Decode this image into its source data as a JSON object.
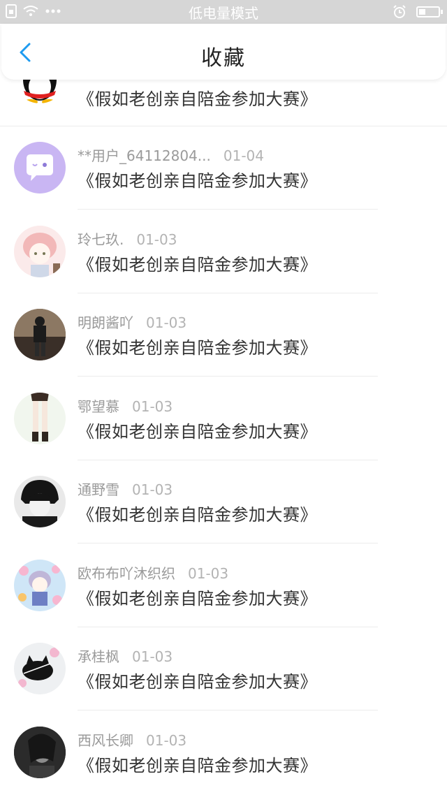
{
  "status_bar": {
    "title": "低电量模式"
  },
  "nav": {
    "title": "收藏"
  },
  "items": [
    {
      "name": "",
      "date": "",
      "text": "《假如老创亲自陪金参加大赛》",
      "avatar": "qq-penguin-avatar"
    },
    {
      "name": "**用户_64112804...",
      "date": "01-04",
      "text": "《假如老创亲自陪金参加大赛》",
      "avatar": "purple-chat-avatar"
    },
    {
      "name": "玲七玖.",
      "date": "01-03",
      "text": "《假如老创亲自陪金参加大赛》",
      "avatar": "anime-pink-hair-avatar"
    },
    {
      "name": "明朗酱吖",
      "date": "01-03",
      "text": "《假如老创亲自陪金参加大赛》",
      "avatar": "street-photo-avatar"
    },
    {
      "name": "鄂望慕",
      "date": "01-03",
      "text": "《假如老创亲自陪金参加大赛》",
      "avatar": "legs-avatar"
    },
    {
      "name": "通野雪",
      "date": "01-03",
      "text": "《假如老创亲自陪金参加大赛》",
      "avatar": "dark-hair-boy-avatar"
    },
    {
      "name": "欧布布吖沐织织",
      "date": "01-03",
      "text": "《假如老创亲自陪金参加大赛》",
      "avatar": "anime-girl-flowers-avatar"
    },
    {
      "name": "承桂枫",
      "date": "01-03",
      "text": "《假如老创亲自陪金参加大赛》",
      "avatar": "black-cat-avatar"
    },
    {
      "name": "西风长卿",
      "date": "01-03",
      "text": "《假如老创亲自陪金参加大赛》",
      "avatar": "dark-portrait-avatar"
    }
  ],
  "colors": {
    "accent": "#1e9bf0",
    "status_bar": "#d6d6d6",
    "divider": "#ececec"
  }
}
